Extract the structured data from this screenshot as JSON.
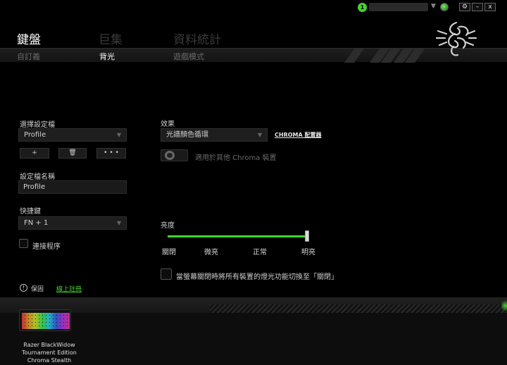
{
  "topbar": {
    "notification_count": "1",
    "window_buttons": [
      "⚙",
      "–",
      "x"
    ]
  },
  "header": {
    "tabs": [
      {
        "label": "鍵盤",
        "state": "active"
      },
      {
        "label": "巨集",
        "state": "inactive"
      },
      {
        "label": "資料統計",
        "state": "inactive"
      }
    ],
    "subtabs": [
      {
        "label": "自訂義",
        "state": "inactive"
      },
      {
        "label": "背光",
        "state": "active"
      },
      {
        "label": "遊戲模式",
        "state": "inactive"
      }
    ]
  },
  "profile": {
    "select_label": "選擇設定檔",
    "select_value": "Profile",
    "add_button": "+",
    "delete_button": "🗑",
    "more_button": "• • •",
    "name_label": "設定檔名稱",
    "name_value": "Profile"
  },
  "shortcut": {
    "label": "快捷鍵",
    "value": "FN + 1"
  },
  "link_program": {
    "label": "連接程序"
  },
  "effect": {
    "label": "效果",
    "value": "光譜顏色循環",
    "chroma_link": "CHROMA 配置器",
    "apply_label": "適用於其他 Chroma 裝置"
  },
  "brightness": {
    "label": "亮度",
    "value_percent": 100,
    "levels": [
      "關閉",
      "微亮",
      "正常",
      "明亮"
    ]
  },
  "screen_off": {
    "label": "當螢幕關閉時將所有裝置的燈光功能切換至「關閉」"
  },
  "help": {
    "label": "保固",
    "link": "線上註冊"
  },
  "device": {
    "name": "Razer BlackWidow Tournament Edition Chroma Stealth"
  },
  "colors": {
    "accent": "#44d62c",
    "background": "#000000",
    "panel": "#1e1e1e"
  }
}
